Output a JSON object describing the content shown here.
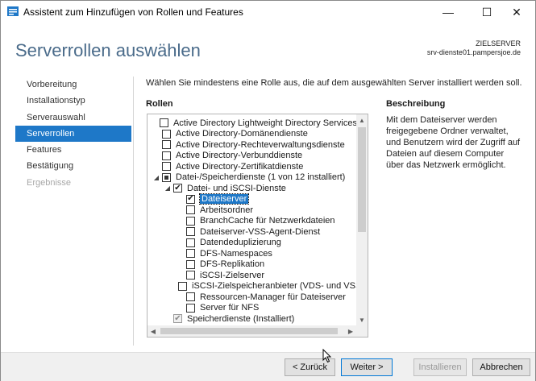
{
  "window": {
    "title": "Assistent zum Hinzufügen von Rollen und Features",
    "minimize": "—",
    "maximize": "☐",
    "close": "✕"
  },
  "header": {
    "page_title": "Serverrollen auswählen",
    "target_label": "ZIELSERVER",
    "target_server": "srv-dienste01.pampersjoe.de"
  },
  "nav": {
    "items": [
      {
        "label": "Vorbereitung",
        "state": "normal"
      },
      {
        "label": "Installationstyp",
        "state": "normal"
      },
      {
        "label": "Serverauswahl",
        "state": "normal"
      },
      {
        "label": "Serverrollen",
        "state": "active"
      },
      {
        "label": "Features",
        "state": "normal"
      },
      {
        "label": "Bestätigung",
        "state": "normal"
      },
      {
        "label": "Ergebnisse",
        "state": "disabled"
      }
    ]
  },
  "main": {
    "instruction": "Wählen Sie mindestens eine Rolle aus, die auf dem ausgewählten Server installiert werden soll.",
    "roles_heading": "Rollen",
    "description_heading": "Beschreibung",
    "description_text": "Mit dem Dateiserver werden freigegebene Ordner verwaltet, und Benutzern wird der Zugriff auf Dateien auf diesem Computer über das Netzwerk ermöglicht."
  },
  "roles": [
    {
      "label": "Active Directory Lightweight Directory Services",
      "level": 0,
      "check": "none",
      "expander": ""
    },
    {
      "label": "Active Directory-Domänendienste",
      "level": 0,
      "check": "none",
      "expander": ""
    },
    {
      "label": "Active Directory-Rechteverwaltungsdienste",
      "level": 0,
      "check": "none",
      "expander": ""
    },
    {
      "label": "Active Directory-Verbunddienste",
      "level": 0,
      "check": "none",
      "expander": ""
    },
    {
      "label": "Active Directory-Zertifikatdienste",
      "level": 0,
      "check": "none",
      "expander": ""
    },
    {
      "label": "Datei-/Speicherdienste (1 von 12 installiert)",
      "level": 0,
      "check": "partial",
      "expander": "◢"
    },
    {
      "label": "Datei- und iSCSI-Dienste",
      "level": 1,
      "check": "checked",
      "expander": "◢"
    },
    {
      "label": "Dateiserver",
      "level": 2,
      "check": "checked",
      "expander": "",
      "selected": true
    },
    {
      "label": "Arbeitsordner",
      "level": 2,
      "check": "none",
      "expander": ""
    },
    {
      "label": "BranchCache für Netzwerkdateien",
      "level": 2,
      "check": "none",
      "expander": ""
    },
    {
      "label": "Dateiserver-VSS-Agent-Dienst",
      "level": 2,
      "check": "none",
      "expander": ""
    },
    {
      "label": "Datendeduplizierung",
      "level": 2,
      "check": "none",
      "expander": ""
    },
    {
      "label": "DFS-Namespaces",
      "level": 2,
      "check": "none",
      "expander": ""
    },
    {
      "label": "DFS-Replikation",
      "level": 2,
      "check": "none",
      "expander": ""
    },
    {
      "label": "iSCSI-Zielserver",
      "level": 2,
      "check": "none",
      "expander": ""
    },
    {
      "label": "iSCSI-Zielspeicheranbieter (VDS- und VSS-H",
      "level": 2,
      "check": "none",
      "expander": ""
    },
    {
      "label": "Ressourcen-Manager für Dateiserver",
      "level": 2,
      "check": "none",
      "expander": ""
    },
    {
      "label": "Server für NFS",
      "level": 2,
      "check": "none",
      "expander": ""
    },
    {
      "label": "Speicherdienste (Installiert)",
      "level": 1,
      "check": "grey",
      "expander": ""
    }
  ],
  "footer": {
    "back_label": "< Zurück",
    "next_label": "Weiter >",
    "install_label": "Installieren",
    "cancel_label": "Abbrechen"
  },
  "colors": {
    "accent": "#1e78c8",
    "title_blue": "#4a6b8a",
    "footer_bg": "#f0f0f0"
  }
}
